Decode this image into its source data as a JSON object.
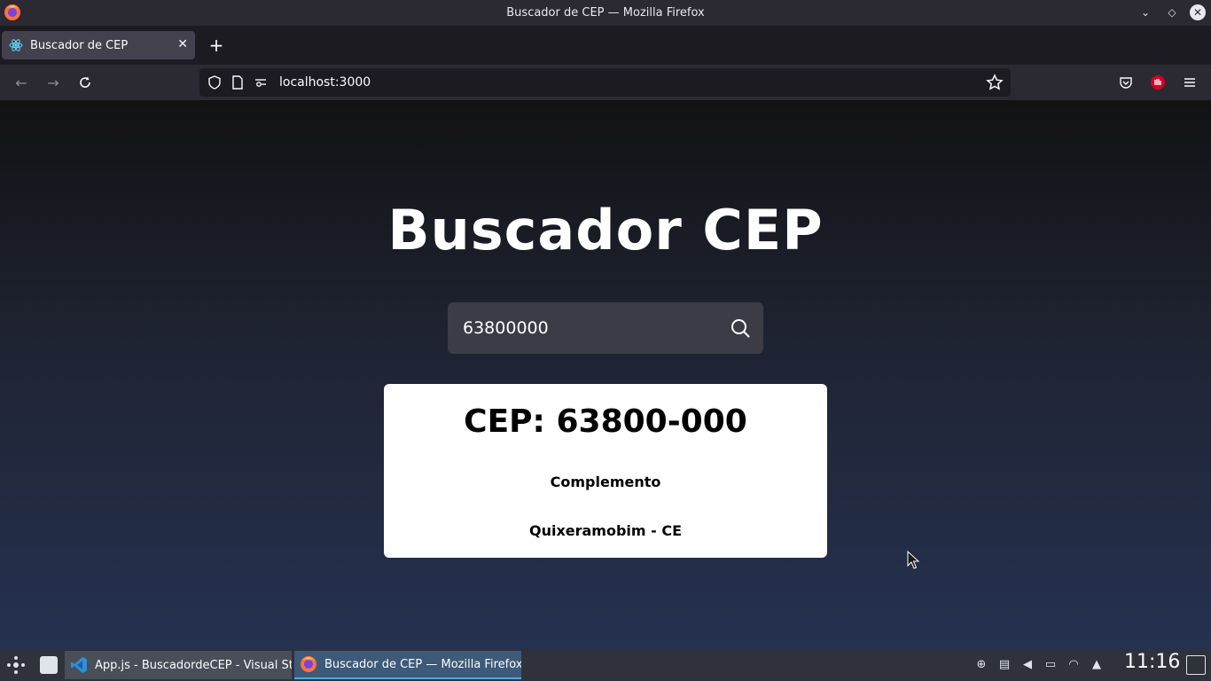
{
  "window": {
    "title": "Buscador de CEP — Mozilla Firefox"
  },
  "tabs": [
    {
      "label": "Buscador de CEP"
    }
  ],
  "navbar": {
    "url": "localhost:3000"
  },
  "page": {
    "title": "Buscador CEP",
    "search": {
      "value": "63800000",
      "placeholder": ""
    },
    "result": {
      "cep": "CEP: 63800-000",
      "complemento": "Complemento",
      "city": "Quixeramobim - CE"
    }
  },
  "taskbar": {
    "tasks": [
      {
        "label": "App.js - BuscadordeCEP - Visual St..."
      },
      {
        "label": "Buscador de CEP — Mozilla Firefox"
      }
    ],
    "clock": "11:16"
  },
  "colors": {
    "accent": "#3daee9",
    "page_gradient_top": "#121214",
    "page_gradient_bottom": "#253150",
    "card": "#ffffff",
    "search_box": "#3b3c46"
  }
}
